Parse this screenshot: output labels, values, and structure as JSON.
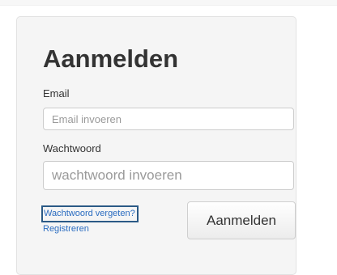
{
  "login": {
    "title": "Aanmelden",
    "email_label": "Email",
    "email_value": "",
    "email_placeholder": "Email invoeren",
    "password_label": "Wachtwoord",
    "password_value": "",
    "password_placeholder": "wachtwoord invoeren",
    "forgot_link": "Wachtwoord vergeten?",
    "register_link": "Registreren",
    "submit_label": "Aanmelden"
  },
  "colors": {
    "link": "#2a6cc0",
    "focus_outline": "#2b5a86",
    "panel_background": "#f5f5f5",
    "text": "#333333"
  }
}
